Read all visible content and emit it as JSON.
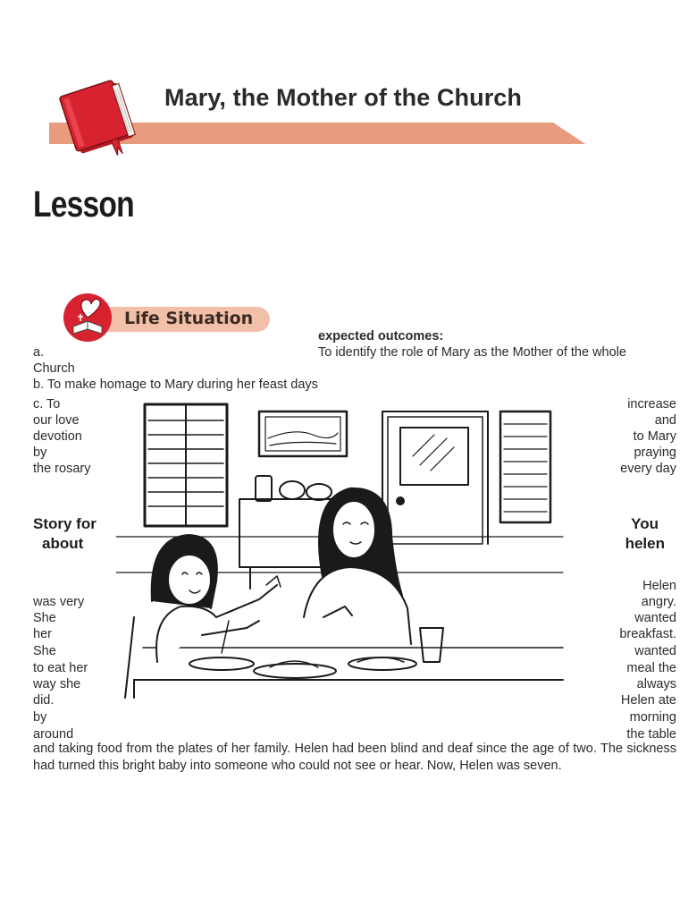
{
  "header": {
    "title": "Mary, the Mother of the Church",
    "accent_color": "#e89b7d",
    "book_color": "#d7232f",
    "icon": "bible-book-icon"
  },
  "lesson_heading": "Lesson",
  "life_situation": {
    "label": "Life Situation",
    "icon": "heart-bible-icon"
  },
  "outcomes": {
    "heading": "expected outcomes:",
    "a_marker": "a.",
    "a_text": "To identify the role of Mary as the Mother of the whole",
    "a_cont": "Church",
    "b_text": "b. To make homage to Mary during her feast days",
    "c_left": [
      "c. To",
      "our love",
      "devotion",
      "by",
      "the rosary"
    ],
    "c_right": [
      "increase",
      "and",
      "to Mary",
      "praying",
      "every day"
    ]
  },
  "story": {
    "left_heading": [
      "Story for",
      "about"
    ],
    "right_heading": [
      "You",
      "helen"
    ],
    "left_lines": [
      "was   very",
      "She",
      "her",
      "She",
      "to eat her",
      "way   she",
      "did.",
      "by",
      "around"
    ],
    "right_lines": [
      "Helen",
      "angry.",
      "wanted",
      "breakfast.",
      "wanted",
      "meal   the",
      "always",
      "Helen  ate",
      "morning",
      "the   table"
    ],
    "paragraph": "and taking food from the plates of her family. Helen had been blind and deaf since the age of two. The sickness had turned this bright baby into someone who could not see or hear. Now, Helen was seven."
  },
  "illustration": {
    "subject": "girl-and-mother-at-breakfast-table"
  }
}
